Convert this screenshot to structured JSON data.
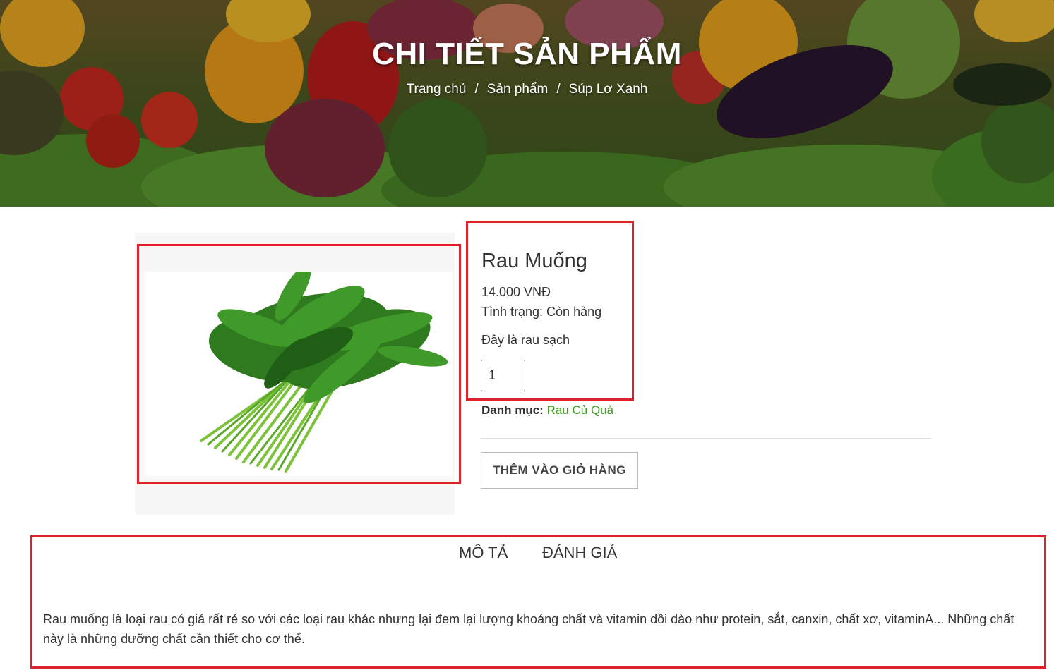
{
  "banner": {
    "title": "CHI TIẾT SẢN PHẨM",
    "breadcrumb": [
      "Trang chủ",
      "Sản phẩm",
      "Súp Lơ Xanh"
    ],
    "separator": "/"
  },
  "product": {
    "name": "Rau Muống",
    "price": "14.000 VNĐ",
    "status": "Tình trạng: Còn hàng",
    "short_description": "Đây là rau sạch",
    "quantity": "1",
    "category_label": "Danh mục:",
    "category_value": "Rau Củ Quả",
    "add_to_cart": "THÊM VÀO GIỎ HÀNG"
  },
  "tabs": {
    "description": "MÔ TẢ",
    "review": "ĐÁNH GIÁ"
  },
  "description_text": "Rau muống là loại rau có giá rất rẻ so với các loại rau khác nhưng lại đem lại lượng khoáng chất và vitamin dồi dào như protein, sắt, canxin, chất xơ, vitaminA... Những chất này là những dưỡng chất cần thiết cho cơ thể.",
  "colors": {
    "highlight": "#e0202a",
    "category_link": "#3c9c1e"
  }
}
